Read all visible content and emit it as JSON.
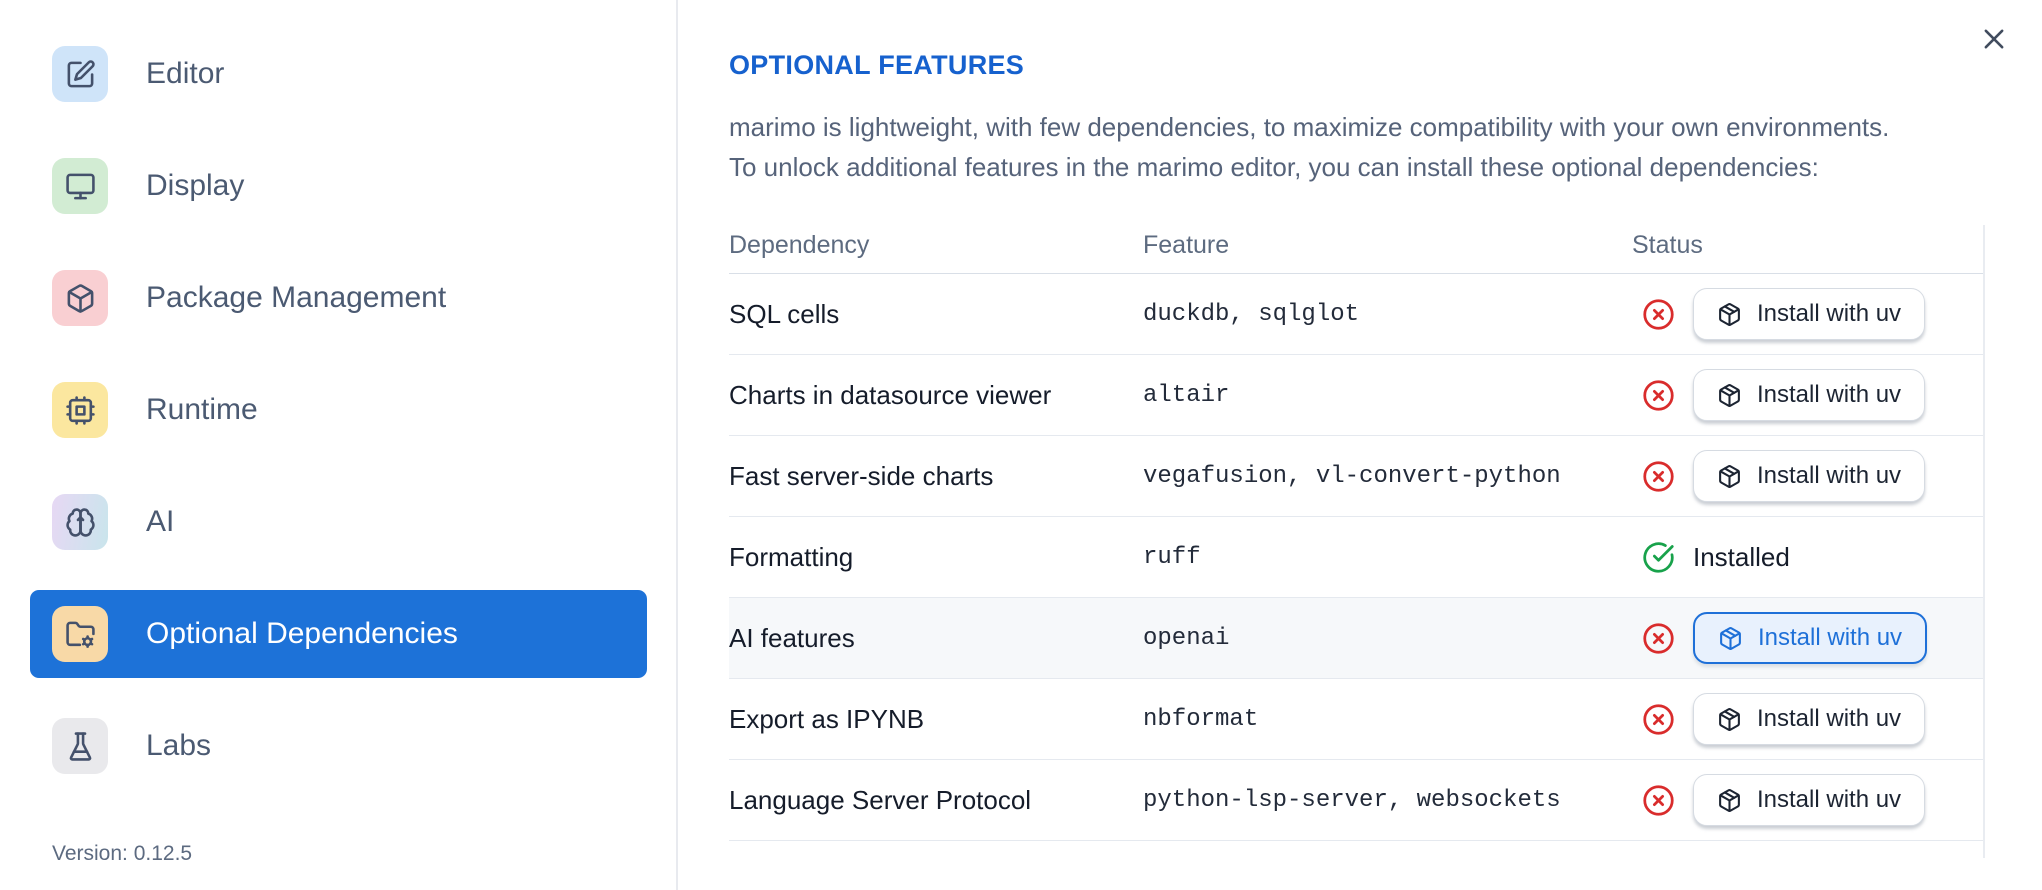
{
  "accent_color": "#1d72d8",
  "title_color": "#1661ce",
  "sidebar": {
    "items": [
      {
        "label": "Editor",
        "icon": "square-pen-icon",
        "tile_color": "#cfe4f9",
        "selected": false
      },
      {
        "label": "Display",
        "icon": "monitor-icon",
        "tile_color": "#d2ecd3",
        "selected": false
      },
      {
        "label": "Package Management",
        "icon": "package-icon",
        "tile_color": "#f9cfd2",
        "selected": false
      },
      {
        "label": "Runtime",
        "icon": "cpu-icon",
        "tile_color": "#fbe79f",
        "selected": false
      },
      {
        "label": "AI",
        "icon": "brain-icon",
        "tile_color": "gradient-lavender-teal",
        "selected": false
      },
      {
        "label": "Optional Dependencies",
        "icon": "folder-cog-icon",
        "tile_color": "#f8d9a7",
        "selected": true
      },
      {
        "label": "Labs",
        "icon": "flask-icon",
        "tile_color": "#e9e9ec",
        "selected": false
      }
    ],
    "version": "Version: 0.12.5"
  },
  "panel": {
    "title": "OPTIONAL FEATURES",
    "description_line1": "marimo is lightweight, with few dependencies, to maximize compatibility with your own environments.",
    "description_line2": "To unlock additional features in the marimo editor, you can install these optional dependencies:",
    "close_icon": "close-icon"
  },
  "table": {
    "headers": [
      "Dependency",
      "Feature",
      "Status"
    ],
    "install_button_label": "Install with uv",
    "installed_label": "Installed",
    "status_icons": {
      "missing": "circle-x-icon",
      "installed": "circle-check-icon",
      "button": "package-icon"
    },
    "status_colors": {
      "missing": "#d92c2c",
      "installed": "#18a24b"
    },
    "rows": [
      {
        "dependency": "SQL cells",
        "feature": "duckdb, sqlglot",
        "status": "missing",
        "highlighted": false
      },
      {
        "dependency": "Charts in datasource viewer",
        "feature": "altair",
        "status": "missing",
        "highlighted": false
      },
      {
        "dependency": "Fast server-side charts",
        "feature": "vegafusion, vl-convert-python",
        "status": "missing",
        "highlighted": false
      },
      {
        "dependency": "Formatting",
        "feature": "ruff",
        "status": "installed",
        "highlighted": false
      },
      {
        "dependency": "AI features",
        "feature": "openai",
        "status": "missing",
        "highlighted": true
      },
      {
        "dependency": "Export as IPYNB",
        "feature": "nbformat",
        "status": "missing",
        "highlighted": false
      },
      {
        "dependency": "Language Server Protocol",
        "feature": "python-lsp-server, websockets",
        "status": "missing",
        "highlighted": false
      }
    ]
  }
}
